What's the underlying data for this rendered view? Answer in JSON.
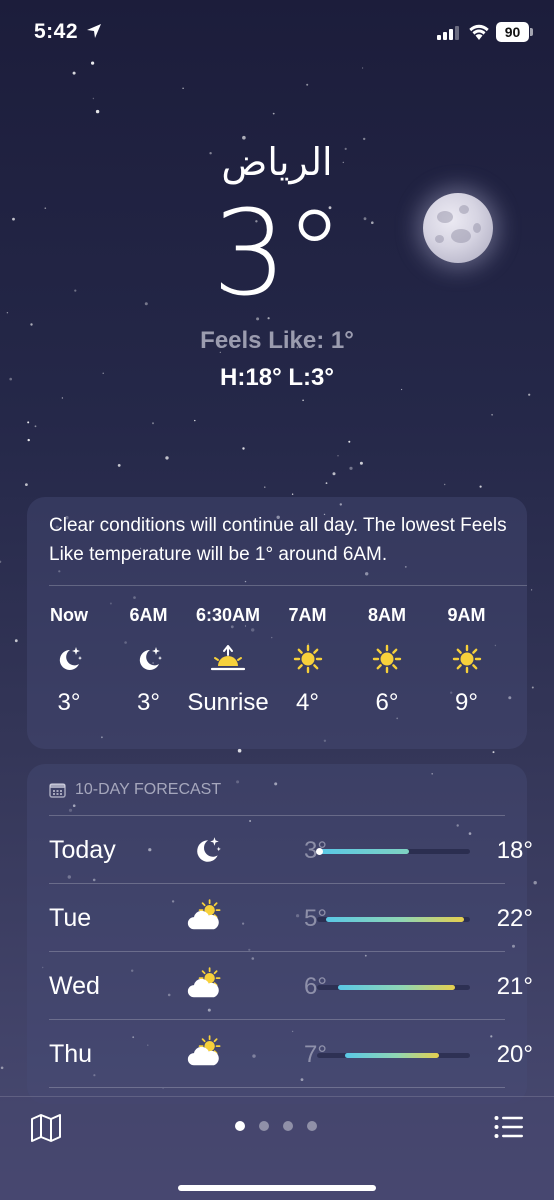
{
  "status_bar": {
    "time": "5:42",
    "battery": "90"
  },
  "location": {
    "city": "الرياض",
    "temperature": "3°",
    "feels_like": "Feels Like: 1°",
    "high_low": "H:18°  L:3°"
  },
  "hourly": {
    "summary": "Clear conditions will continue all day. The lowest Feels Like temperature will be 1° around 6AM.",
    "hours": [
      {
        "label": "Now",
        "icon": "moon-stars-icon",
        "temp": "3°"
      },
      {
        "label": "6AM",
        "icon": "moon-stars-icon",
        "temp": "3°"
      },
      {
        "label": "6:30AM",
        "icon": "sunrise-icon",
        "temp": "Sunrise"
      },
      {
        "label": "7AM",
        "icon": "sun-icon",
        "temp": "4°"
      },
      {
        "label": "8AM",
        "icon": "sun-icon",
        "temp": "6°"
      },
      {
        "label": "9AM",
        "icon": "sun-icon",
        "temp": "9°"
      }
    ]
  },
  "daily": {
    "header": "10-DAY FORECAST",
    "days": [
      {
        "name": "Today",
        "icon": "moon-stars-icon",
        "low": "3°",
        "high": "18°",
        "range": [
          0.02,
          0.6
        ],
        "current": 0.02
      },
      {
        "name": "Tue",
        "icon": "partly-cloudy-icon",
        "low": "5°",
        "high": "22°",
        "range": [
          0.06,
          0.96
        ]
      },
      {
        "name": "Wed",
        "icon": "partly-cloudy-icon",
        "low": "6°",
        "high": "21°",
        "range": [
          0.14,
          0.9
        ]
      },
      {
        "name": "Thu",
        "icon": "partly-cloudy-icon",
        "low": "7°",
        "high": "20°",
        "range": [
          0.18,
          0.8
        ]
      }
    ]
  },
  "pager": {
    "count": 4,
    "active": 0
  },
  "colors": {
    "bar_cool": "#5ac8e6",
    "bar_warm": "#e6cf4e",
    "sun": "#f7d13b"
  }
}
